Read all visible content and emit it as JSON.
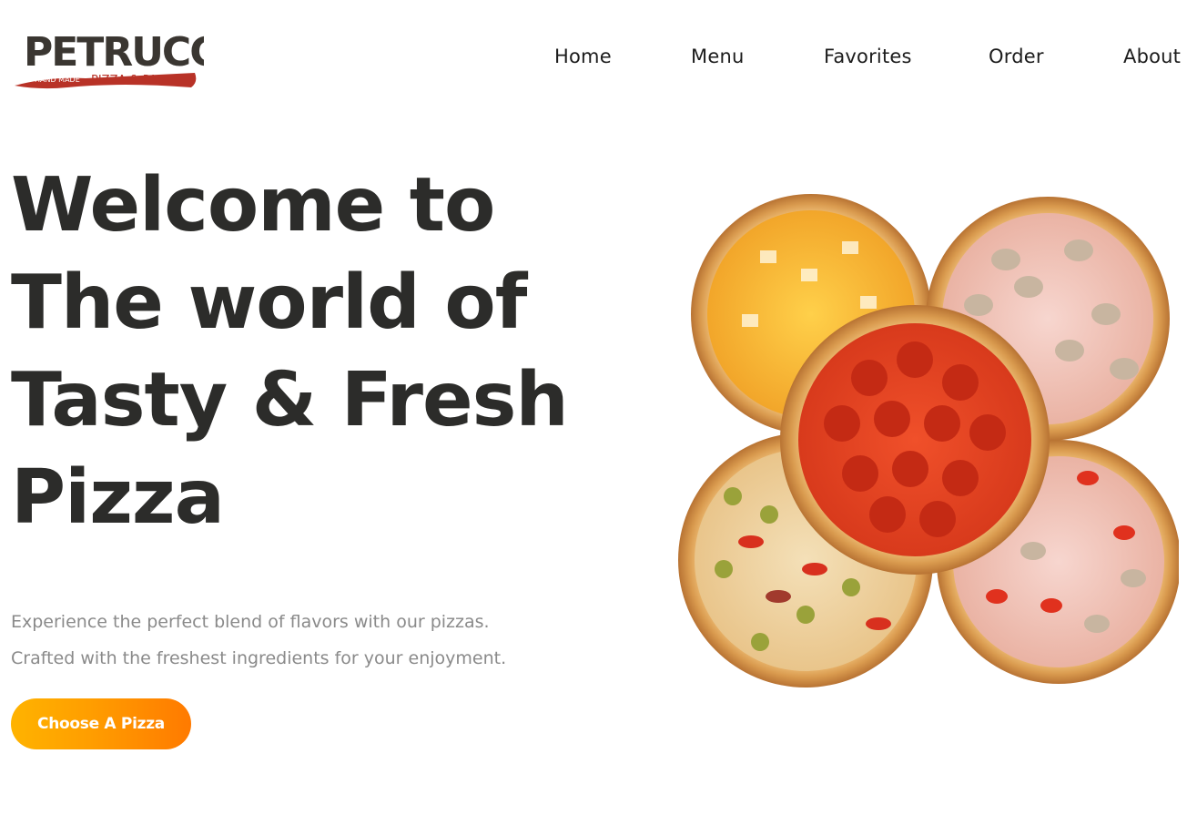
{
  "brand": {
    "name": "PETRUCCIO",
    "tagline_left": "HAND MADE",
    "tagline_right": "PIZZA & PASTA"
  },
  "nav": {
    "items": [
      "Home",
      "Menu",
      "Favorites",
      "Order",
      "About"
    ]
  },
  "hero": {
    "title_lines": [
      "Welcome to",
      "The world of",
      "Tasty & Fresh",
      "Pizza"
    ],
    "description_lines": [
      "Experience the perfect blend of flavors with our pizzas.",
      "Crafted with the freshest ingredients for your enjoyment."
    ],
    "cta_label": "Choose A Pizza"
  },
  "colors": {
    "heading": "#2c2c2a",
    "body_text": "#8a8a8a",
    "accent_start": "#ffb300",
    "accent_end": "#ff7a00",
    "logo_red": "#b83227",
    "logo_dark": "#3a3631"
  },
  "images": {
    "hero_image": "five-pizzas-arrangement"
  }
}
